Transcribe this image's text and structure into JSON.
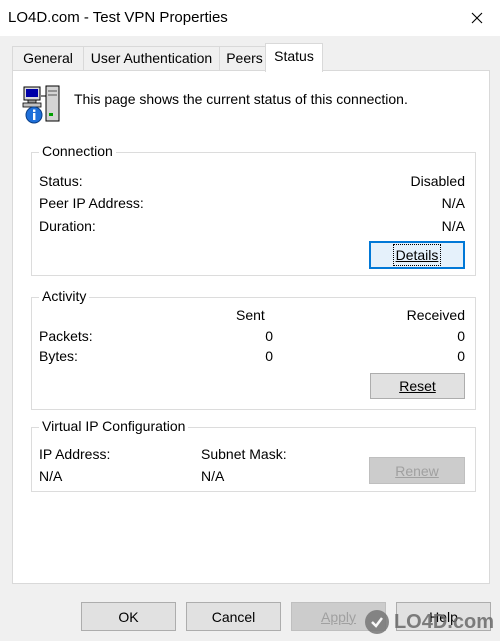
{
  "window": {
    "title": "LO4D.com  - Test VPN Properties"
  },
  "tabs": [
    {
      "label": "General",
      "active": false
    },
    {
      "label": "User Authentication",
      "active": false
    },
    {
      "label": "Peers",
      "active": false
    },
    {
      "label": "Status",
      "active": true
    }
  ],
  "header": {
    "text": "This page shows the current status of this connection."
  },
  "connection": {
    "title": "Connection",
    "status_label": "Status:",
    "status_value": "Disabled",
    "peer_label": "Peer IP Address:",
    "peer_value": "N/A",
    "duration_label": "Duration:",
    "duration_value": "N/A",
    "details_button": "Details"
  },
  "activity": {
    "title": "Activity",
    "sent_header": "Sent",
    "received_header": "Received",
    "packets_label": "Packets:",
    "packets_sent": "0",
    "packets_received": "0",
    "bytes_label": "Bytes:",
    "bytes_sent": "0",
    "bytes_received": "0",
    "reset_button": "Reset"
  },
  "virtual_ip": {
    "title": "Virtual IP Configuration",
    "ip_label": "IP Address:",
    "ip_value": "N/A",
    "subnet_label": "Subnet Mask:",
    "subnet_value": "N/A",
    "renew_button": "Renew"
  },
  "footer": {
    "ok": "OK",
    "cancel": "Cancel",
    "apply": "Apply",
    "help": "Help"
  },
  "watermark": {
    "text": "LO4D.com"
  },
  "colors": {
    "focus_blue": "#0078d7",
    "window_bg": "#f0f0f0",
    "panel_bg": "#ffffff"
  }
}
